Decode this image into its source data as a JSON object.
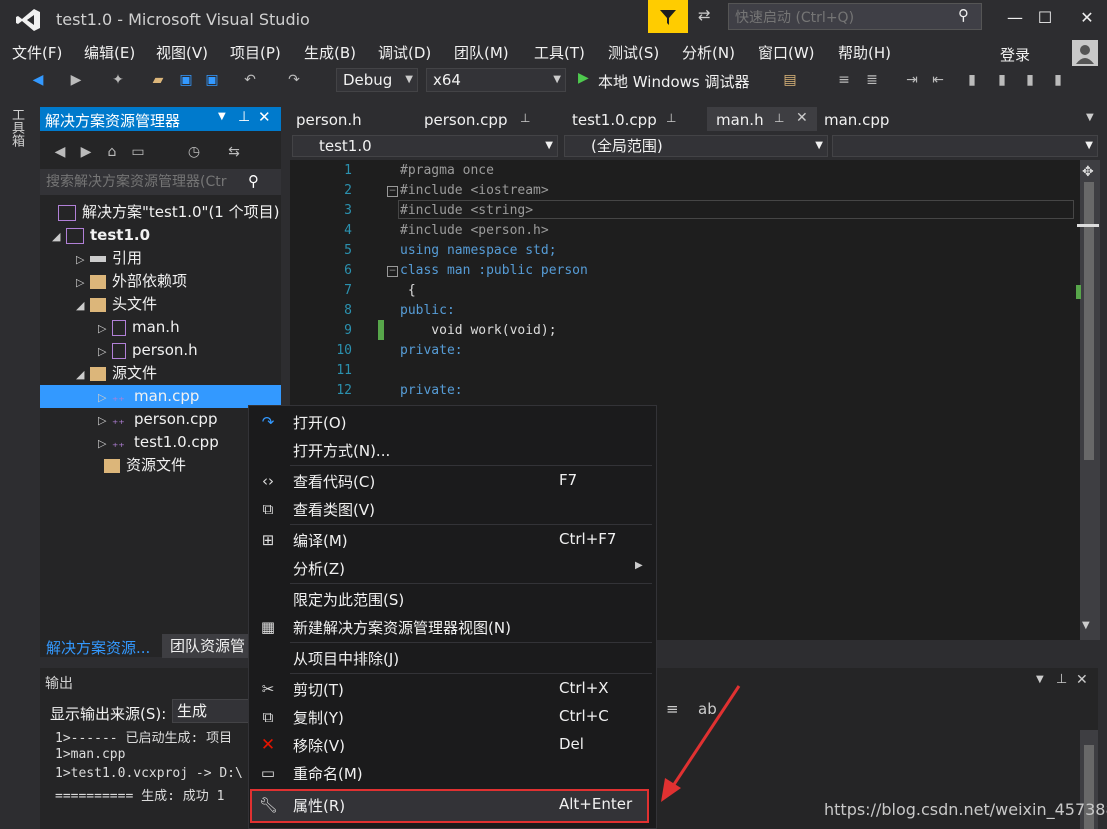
{
  "window": {
    "title": "test1.0 - Microsoft Visual Studio",
    "quick_launch_placeholder": "快速启动 (Ctrl+Q)"
  },
  "menu": [
    "文件(F)",
    "编辑(E)",
    "视图(V)",
    "项目(P)",
    "生成(B)",
    "调试(D)",
    "团队(M)",
    "工具(T)",
    "测试(S)",
    "分析(N)",
    "窗口(W)",
    "帮助(H)"
  ],
  "account": {
    "login": "登录"
  },
  "toolbar": {
    "config": "Debug",
    "platform": "x64",
    "run_label": "本地 Windows 调试器"
  },
  "toolbox_label": "工具箱",
  "solution_explorer": {
    "title": "解决方案资源管理器",
    "search_placeholder": "搜索解决方案资源管理器(Ctr",
    "tree": [
      {
        "label": "解决方案\"test1.0\"(1 个项目)"
      },
      {
        "label": "test1.0"
      },
      {
        "label": "引用"
      },
      {
        "label": "外部依赖项"
      },
      {
        "label": "头文件"
      },
      {
        "label": "man.h"
      },
      {
        "label": "person.h"
      },
      {
        "label": "源文件"
      },
      {
        "label": "man.cpp"
      },
      {
        "label": "person.cpp"
      },
      {
        "label": "test1.0.cpp"
      },
      {
        "label": "资源文件"
      }
    ],
    "bottom_tabs": [
      "解决方案资源...",
      "团队资源管"
    ]
  },
  "editor": {
    "tabs": [
      "person.h",
      "person.cpp",
      "test1.0.cpp",
      "man.h",
      "man.cpp"
    ],
    "active_tab": "man.h",
    "nav_project": "test1.0",
    "nav_scope": "(全局范围)",
    "line_numbers": [
      "1",
      "2",
      "3",
      "4",
      "5",
      "6",
      "7",
      "8",
      "9",
      "10",
      "11",
      "12"
    ],
    "lines": [
      "#pragma once",
      "#include <iostream>",
      "#include <string>",
      "#include <person.h>",
      "using namespace std;",
      "class man :public person",
      " {",
      "public:",
      "    void work(void);",
      "private:",
      "",
      "private:"
    ]
  },
  "output": {
    "title": "输出",
    "source_label": "显示输出来源(S):",
    "source_value": "生成",
    "lines": [
      "1>------ 已启动生成: 项目",
      "1>man.cpp",
      "1>test1.0.vcxproj -> D:\\",
      "========== 生成: 成功 1"
    ]
  },
  "context_menu": [
    {
      "label": "打开(O)",
      "shortcut": "",
      "icon": "open-icon"
    },
    {
      "label": "打开方式(N)...",
      "shortcut": "",
      "icon": ""
    },
    {
      "label": "查看代码(C)",
      "shortcut": "F7",
      "icon": "code-icon"
    },
    {
      "label": "查看类图(V)",
      "shortcut": "",
      "icon": "class-diagram-icon"
    },
    {
      "label": "编译(M)",
      "shortcut": "Ctrl+F7",
      "icon": "compile-icon"
    },
    {
      "label": "分析(Z)",
      "shortcut": "",
      "icon": ""
    },
    {
      "label": "限定为此范围(S)",
      "shortcut": "",
      "icon": ""
    },
    {
      "label": "新建解决方案资源管理器视图(N)",
      "shortcut": "",
      "icon": "new-view-icon"
    },
    {
      "label": "从项目中排除(J)",
      "shortcut": "",
      "icon": ""
    },
    {
      "label": "剪切(T)",
      "shortcut": "Ctrl+X",
      "icon": "cut-icon"
    },
    {
      "label": "复制(Y)",
      "shortcut": "Ctrl+C",
      "icon": "copy-icon"
    },
    {
      "label": "移除(V)",
      "shortcut": "Del",
      "icon": "remove-icon"
    },
    {
      "label": "重命名(M)",
      "shortcut": "",
      "icon": "rename-icon"
    },
    {
      "label": "属性(R)",
      "shortcut": "Alt+Enter",
      "icon": "wrench-icon"
    }
  ],
  "watermark": "https://blog.csdn.net/weixin_45738823",
  "colors": {
    "accent": "#007acc",
    "selection": "#3399ff",
    "highlight_box": "#e03131",
    "annotation_arrow": "#e03131"
  }
}
